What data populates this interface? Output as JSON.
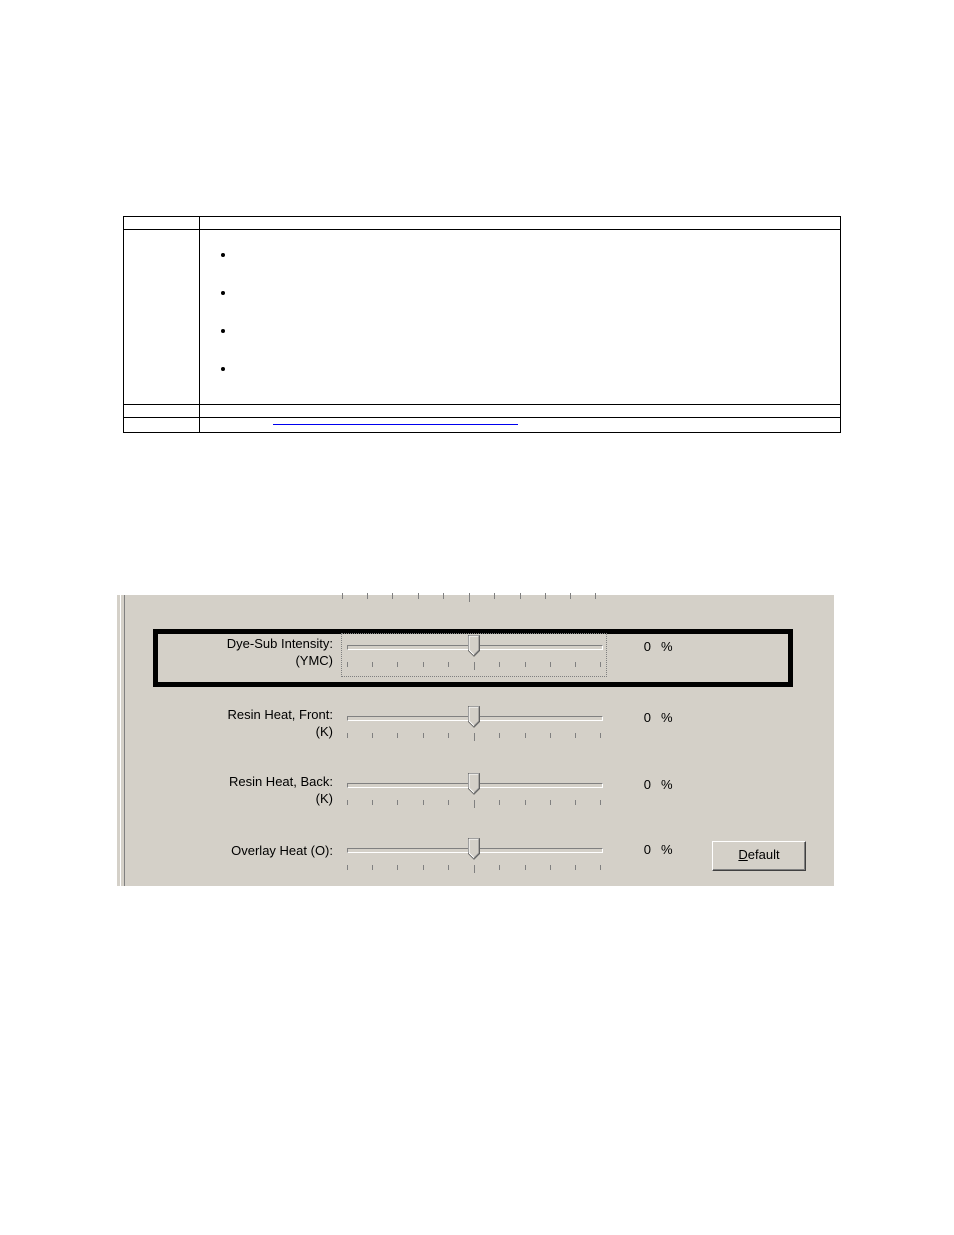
{
  "doc": {
    "rows": {
      "r1": {
        "label": "",
        "content": ""
      },
      "r2": {
        "label": "",
        "bullets": [
          "",
          "",
          "",
          ""
        ]
      },
      "r3": {
        "label": "",
        "content": ""
      },
      "r4": {
        "label": "",
        "prefix": "",
        "link": "",
        "suffix": ""
      }
    }
  },
  "dialog": {
    "sliders": [
      {
        "label_line1": "Dye-Sub Intensity:",
        "label_line2": "(YMC)",
        "value": "0",
        "pct": "%",
        "highlighted": true,
        "focus": true,
        "name": "dye-sub-intensity"
      },
      {
        "label_line1": "Resin Heat, Front:",
        "label_line2": "(K)",
        "value": "0",
        "pct": "%",
        "name": "resin-heat-front"
      },
      {
        "label_line1": "Resin Heat, Back:",
        "label_line2": "(K)",
        "value": "0",
        "pct": "%",
        "name": "resin-heat-back"
      },
      {
        "label_line1": "Overlay Heat  (O):",
        "label_line2": "",
        "value": "0",
        "pct": "%",
        "name": "overlay-heat"
      }
    ],
    "default_button": {
      "mnemonic": "D",
      "rest": "efault"
    }
  }
}
